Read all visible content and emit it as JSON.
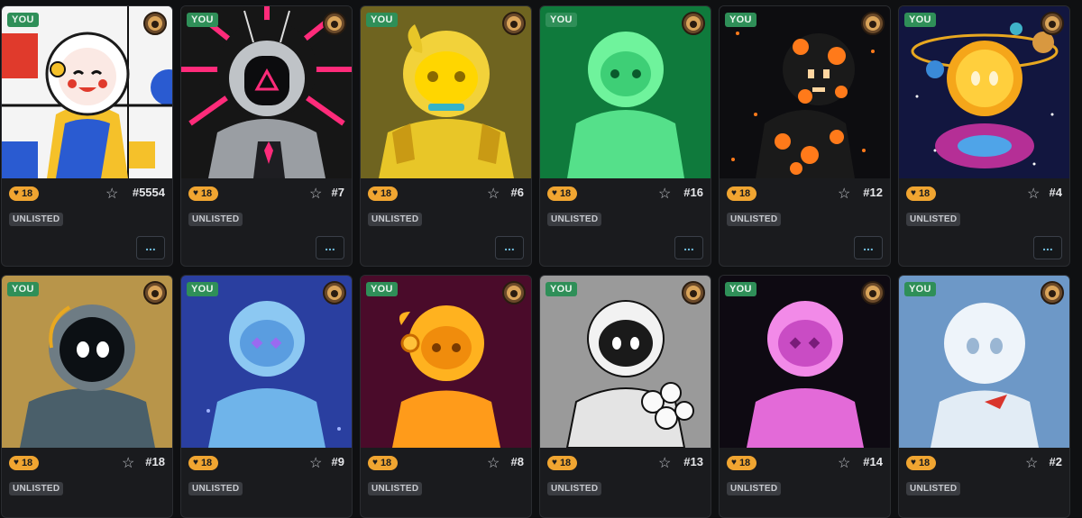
{
  "badges": {
    "you": "YOU",
    "status": "UNLISTED",
    "more": "...",
    "likes": "18"
  },
  "cards": [
    {
      "number": "#5554",
      "theme": "mondrian",
      "bg": "#f4f4f4"
    },
    {
      "number": "#7",
      "theme": "cyber",
      "bg": "#161616"
    },
    {
      "number": "#6",
      "theme": "gold",
      "bg": "#6f6420"
    },
    {
      "number": "#16",
      "theme": "green",
      "bg": "#0f7a3c"
    },
    {
      "number": "#12",
      "theme": "lava",
      "bg": "#0d0d10"
    },
    {
      "number": "#4",
      "theme": "space",
      "bg": "#12163f"
    },
    {
      "number": "#18",
      "theme": "tan",
      "bg": "#b8954a"
    },
    {
      "number": "#9",
      "theme": "ice",
      "bg": "#2a3fa0"
    },
    {
      "number": "#8",
      "theme": "orange",
      "bg": "#4a0b2a"
    },
    {
      "number": "#13",
      "theme": "mono",
      "bg": "#9a9a9a"
    },
    {
      "number": "#14",
      "theme": "pink",
      "bg": "#0e0a12"
    },
    {
      "number": "#2",
      "theme": "cloud",
      "bg": "#6d98c7"
    }
  ]
}
